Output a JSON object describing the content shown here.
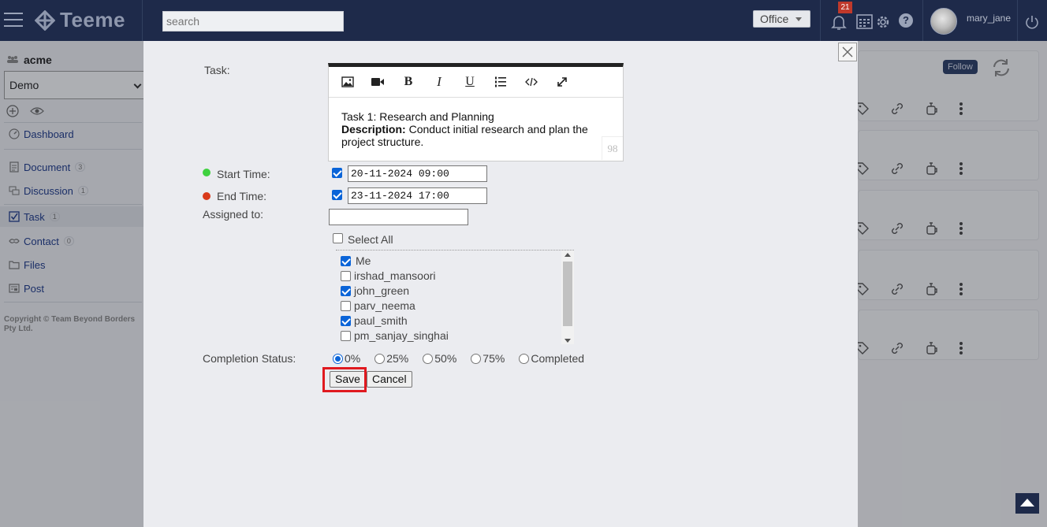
{
  "header": {
    "brand": "Teeme",
    "search_placeholder": "search",
    "workspace": "Office",
    "notification_count": "21",
    "help_label": "?",
    "username": "mary_jane"
  },
  "sidebar": {
    "org_name": "acme",
    "group": "Demo",
    "items": [
      {
        "label": "Dashboard",
        "icon": "dashboard-icon"
      },
      {
        "label": "Document",
        "count": "3",
        "icon": "document-icon"
      },
      {
        "label": "Discussion",
        "count": "1",
        "icon": "discussion-icon"
      },
      {
        "label": "Task",
        "count": "1",
        "icon": "task-icon"
      },
      {
        "label": "Contact",
        "count": "0",
        "icon": "contact-icon"
      },
      {
        "label": "Files",
        "icon": "folder-icon"
      },
      {
        "label": "Post",
        "icon": "post-icon"
      }
    ],
    "copyright": "Copyright © Team Beyond Borders Pty Ltd."
  },
  "background": {
    "follow_label": "Follow"
  },
  "modal": {
    "task_label": "Task:",
    "editor": {
      "title_line": "Task 1: Research and Planning",
      "description_label": "Description:",
      "description_text": "Conduct initial research and plan the project structure.",
      "char_count": "98",
      "toolbar": [
        "image-icon",
        "video-icon",
        "bold-icon",
        "italic-icon",
        "underline-icon",
        "list-icon",
        "code-icon",
        "fullscreen-icon"
      ]
    },
    "start_time_label": "Start Time:",
    "start_time_value": "20-11-2024 09:00",
    "start_time_enabled": true,
    "end_time_label": "End Time:",
    "end_time_value": "23-11-2024 17:00",
    "end_time_enabled": true,
    "start_dot_color": "#3fd13f",
    "end_dot_color": "#d93a1a",
    "assigned_label": "Assigned to:",
    "assigned_value": "",
    "select_all_label": "Select All",
    "select_all_checked": false,
    "users": [
      {
        "name": "Me",
        "checked": true
      },
      {
        "name": "irshad_mansoori",
        "checked": false
      },
      {
        "name": "john_green",
        "checked": true
      },
      {
        "name": "parv_neema",
        "checked": false
      },
      {
        "name": "paul_smith",
        "checked": true
      },
      {
        "name": "pm_sanjay_singhai",
        "checked": false
      }
    ],
    "completion_label": "Completion Status:",
    "completion_options": [
      "0%",
      "25%",
      "50%",
      "75%",
      "Completed"
    ],
    "completion_selected": "0%",
    "save_label": "Save",
    "cancel_label": "Cancel",
    "highlight_color": "#e0191f"
  }
}
